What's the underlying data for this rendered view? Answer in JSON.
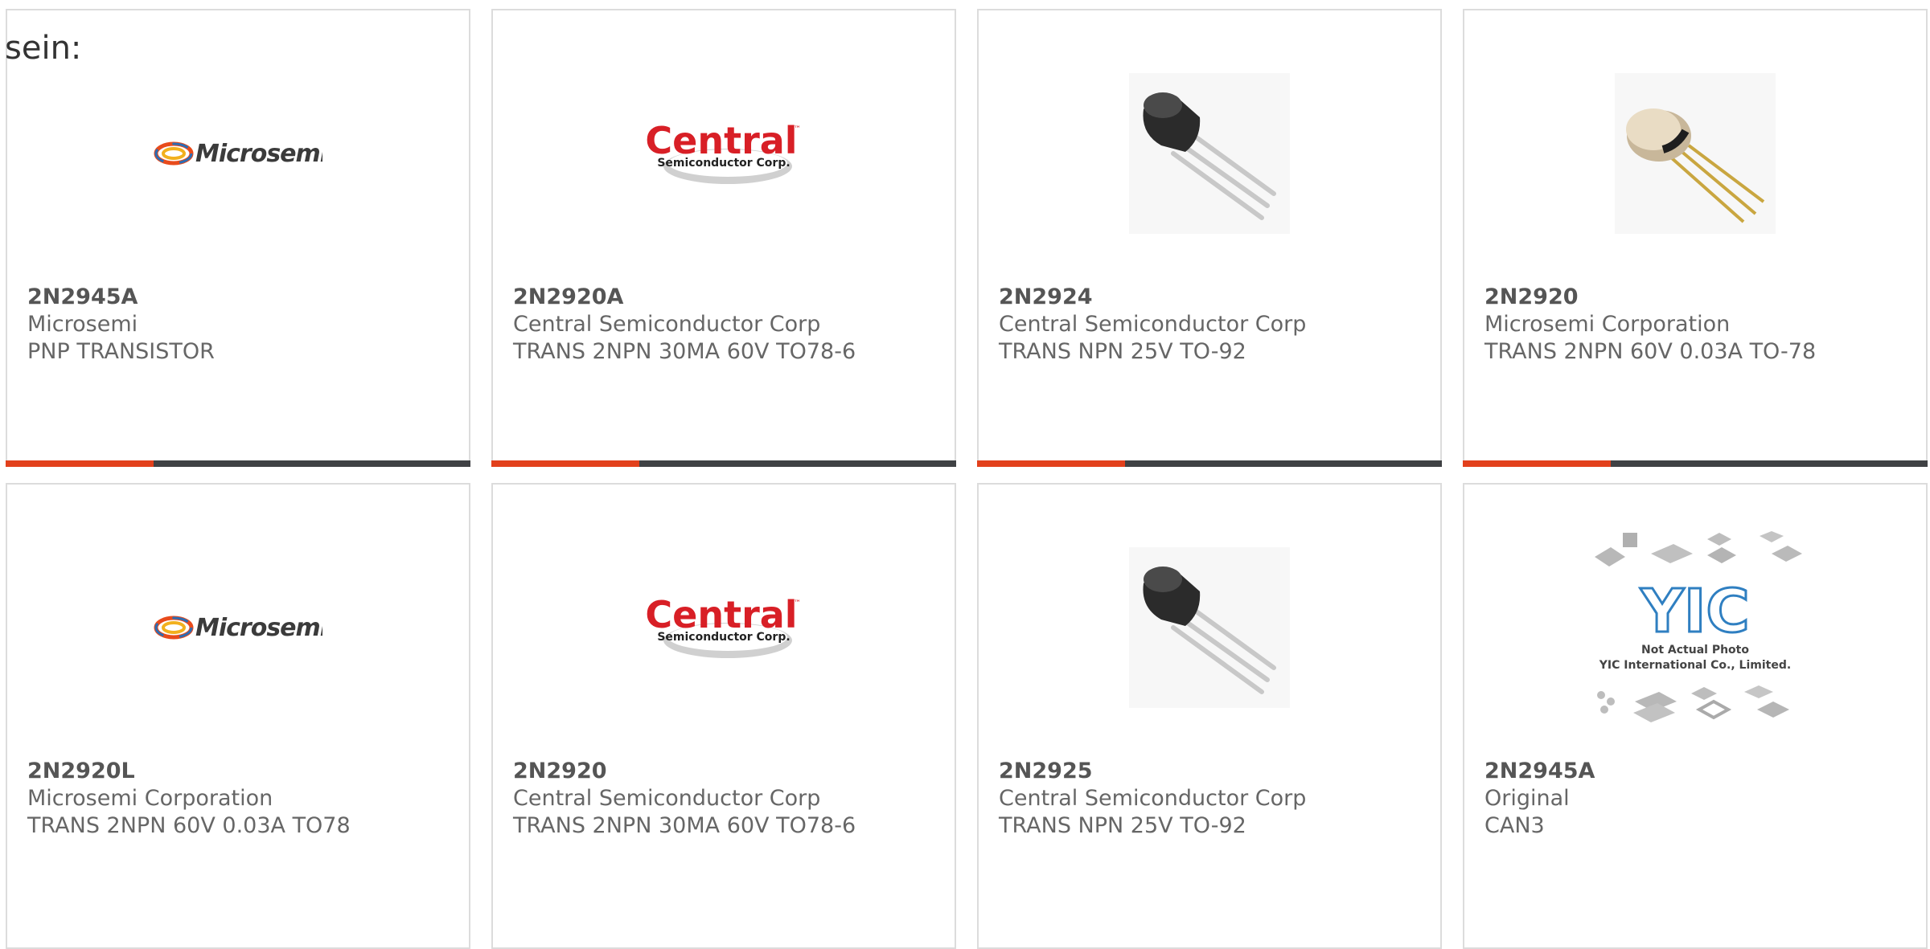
{
  "intro_text": "sein:",
  "accent_color": "#e2401c",
  "bar_color": "#3f4144",
  "cards": [
    {
      "part": "2N2945A",
      "maker": "Microsemi",
      "desc": "PNP TRANSISTOR",
      "image": "microsemi-logo"
    },
    {
      "part": "2N2920A",
      "maker": "Central Semiconductor Corp",
      "desc": "TRANS 2NPN 30MA 60V TO78-6",
      "image": "central-logo"
    },
    {
      "part": "2N2924",
      "maker": "Central Semiconductor Corp",
      "desc": "TRANS NPN 25V TO-92",
      "image": "to92-transistor"
    },
    {
      "part": "2N2920",
      "maker": "Microsemi Corporation",
      "desc": "TRANS 2NPN 60V 0.03A TO-78",
      "image": "to78-can-transistor"
    },
    {
      "part": "2N2920L",
      "maker": "Microsemi Corporation",
      "desc": "TRANS 2NPN 60V 0.03A TO78",
      "image": "microsemi-logo"
    },
    {
      "part": "2N2920",
      "maker": "Central Semiconductor Corp",
      "desc": "TRANS 2NPN 30MA 60V TO78-6",
      "image": "central-logo"
    },
    {
      "part": "2N2925",
      "maker": "Central Semiconductor Corp",
      "desc": "TRANS NPN 25V TO-92",
      "image": "to92-transistor"
    },
    {
      "part": "2N2945A",
      "maker": "Original",
      "desc": "CAN3",
      "image": "yic-placeholder"
    }
  ],
  "logos": {
    "microsemi": "Microsemi",
    "central": "Central",
    "central_sub": "Semiconductor Corp.",
    "tm": "™",
    "yic_mark": "YIC",
    "yic_line1": "Not Actual Photo",
    "yic_line2": "YIC International Co., Limited."
  }
}
